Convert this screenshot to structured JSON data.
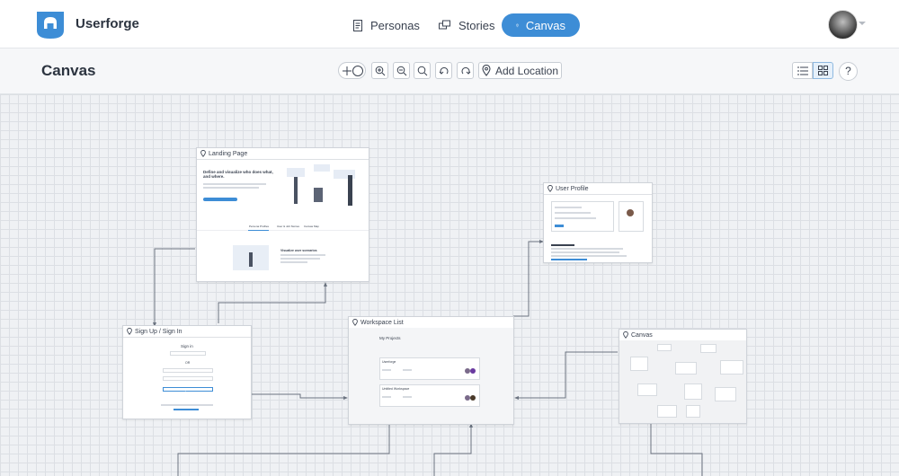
{
  "app": {
    "name": "Userforge"
  },
  "nav": [
    {
      "label": "Personas",
      "icon": "document-icon"
    },
    {
      "label": "Stories",
      "icon": "stack-icon"
    },
    {
      "label": "Canvas",
      "icon": "location-pin-icon",
      "active": true
    }
  ],
  "toolbar": {
    "title": "Canvas",
    "add_location_label": "Add Location",
    "help_label": "?"
  },
  "cards": {
    "landing": {
      "title": "Landing Page",
      "headline": "Define and visualize who does what, and where.",
      "tabs": [
        "Persona Profiles",
        "User & Job Stories",
        "Canvas Map"
      ],
      "feature_text": "Visualize user scenarios"
    },
    "profile": {
      "title": "User Profile"
    },
    "signup": {
      "title": "Sign Up / Sign In",
      "heading": "Sign in",
      "or_label": "OR",
      "button_label": "Sign In"
    },
    "workspace": {
      "title": "Workspace List",
      "heading": "My Projects",
      "project1": "Userforge",
      "project2": "Untitled Workspace"
    },
    "canvas": {
      "title": "Canvas"
    }
  },
  "colors": {
    "accent": "#3d8dd6",
    "canvas_bg": "#eff1f4",
    "grid": "#dcdfe4"
  }
}
